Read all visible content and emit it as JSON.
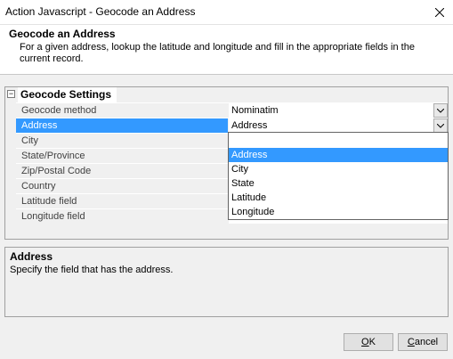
{
  "window": {
    "title": "Action Javascript - Geocode an Address"
  },
  "header": {
    "title": "Geocode an Address",
    "description": "For a given address, lookup the latitude and longitude and fill in the appropriate fields in the current record."
  },
  "grid": {
    "category": {
      "toggle": "−",
      "label": "Geocode Settings"
    },
    "properties": [
      {
        "name": "Geocode method",
        "value": "Nominatim"
      },
      {
        "name": "Address",
        "value": "Address"
      },
      {
        "name": "City",
        "value": ""
      },
      {
        "name": "State/Province",
        "value": ""
      },
      {
        "name": "Zip/Postal Code",
        "value": ""
      },
      {
        "name": "Country",
        "value": ""
      },
      {
        "name": "Latitude field",
        "value": ""
      },
      {
        "name": "Longitude field",
        "value": ""
      }
    ],
    "dropdown_options": [
      "",
      "Address",
      "City",
      "State",
      "Latitude",
      "Longitude"
    ]
  },
  "description_panel": {
    "title": "Address",
    "text": "Specify the field that has the address."
  },
  "buttons": {
    "ok": {
      "underlined": "O",
      "rest": "K"
    },
    "cancel": {
      "underlined": "C",
      "rest": "ancel"
    }
  },
  "colors": {
    "selection": "#3399ff"
  },
  "icons": {
    "close": "close-icon",
    "dropdown": "chevron-down-icon",
    "collapse": "collapse-icon"
  }
}
